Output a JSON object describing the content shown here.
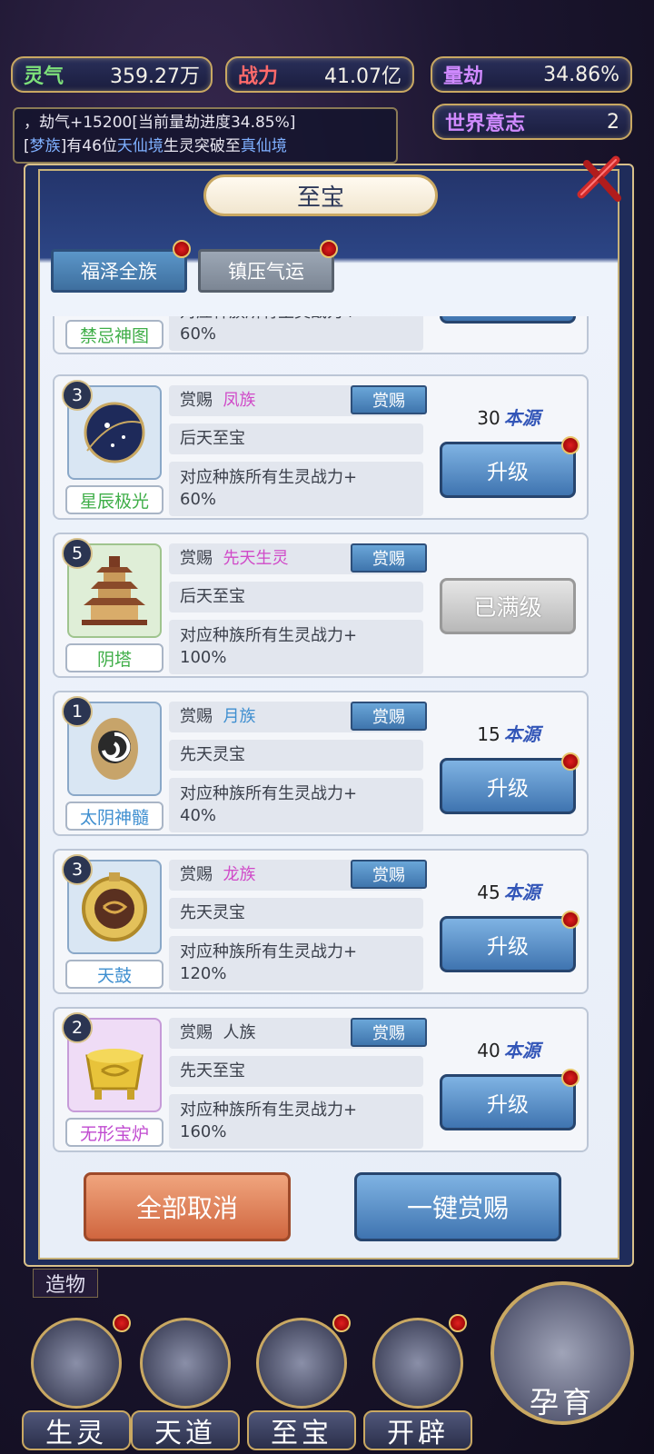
{
  "stats": {
    "lingqi": {
      "label": "灵气",
      "value": "359.27万"
    },
    "zhanli": {
      "label": "战力",
      "value": "41.07亿"
    },
    "liangjie": {
      "label": "量劫",
      "value": "34.86%"
    },
    "will": {
      "label": "世界意志",
      "value": "2"
    }
  },
  "log": {
    "line1": "，劫气+15200[当前量劫进度34.85%]",
    "line2_prefix": "梦族",
    "line2_text": "有46位",
    "line2_realm": "天仙境",
    "line2_text2": "生灵突破至",
    "line2_realm2": "真仙境"
  },
  "modal": {
    "title": "至宝",
    "tabs": [
      "福泽全族",
      "镇压气运"
    ]
  },
  "partial_card": {
    "name": "禁忌神图",
    "desc_line1": "对应种族所有生灵战力+",
    "desc_line2": "60%"
  },
  "cards": [
    {
      "level": "3",
      "name": "星辰极光",
      "name_color": "green",
      "reward_label": "赏赐",
      "race": "凤族",
      "race_color": "pink",
      "type": "后天至宝",
      "desc1": "对应种族所有生灵战力+",
      "desc2": "60%",
      "cost": "30",
      "cost_unit": "本源",
      "button": "升级",
      "reward_btn": "赏赐",
      "maxed": false,
      "thumb": "blue-orb"
    },
    {
      "level": "5",
      "name": "阴塔",
      "name_color": "green",
      "reward_label": "赏赐",
      "race": "先天生灵",
      "race_color": "pink",
      "type": "后天至宝",
      "desc1": "对应种族所有生灵战力+",
      "desc2": "100%",
      "cost": "",
      "cost_unit": "",
      "button": "已满级",
      "reward_btn": "赏赐",
      "maxed": true,
      "thumb": "pagoda"
    },
    {
      "level": "1",
      "name": "太阴神髓",
      "name_color": "blue",
      "reward_label": "赏赐",
      "race": "月族",
      "race_color": "blue",
      "type": "先天灵宝",
      "desc1": "对应种族所有生灵战力+",
      "desc2": "40%",
      "cost": "15",
      "cost_unit": "本源",
      "button": "升级",
      "reward_btn": "赏赐",
      "maxed": false,
      "thumb": "swirl"
    },
    {
      "level": "3",
      "name": "天鼓",
      "name_color": "blue",
      "reward_label": "赏赐",
      "race": "龙族",
      "race_color": "pink",
      "type": "先天灵宝",
      "desc1": "对应种族所有生灵战力+",
      "desc2": "120%",
      "cost": "45",
      "cost_unit": "本源",
      "button": "升级",
      "reward_btn": "赏赐",
      "maxed": false,
      "thumb": "drum"
    },
    {
      "level": "2",
      "name": "无形宝炉",
      "name_color": "purple",
      "reward_label": "赏赐",
      "race": "人族",
      "race_color": "dark",
      "type": "先天至宝",
      "desc1": "对应种族所有生灵战力+",
      "desc2": "160%",
      "cost": "40",
      "cost_unit": "本源",
      "button": "升级",
      "reward_btn": "赏赐",
      "maxed": false,
      "thumb": "cauldron"
    }
  ],
  "actions": {
    "cancel_all": "全部取消",
    "one_key_reward": "一键赏赐"
  },
  "side_label": "造物",
  "nav": [
    "生灵",
    "天道",
    "至宝",
    "开辟"
  ],
  "nurture": "孕育"
}
